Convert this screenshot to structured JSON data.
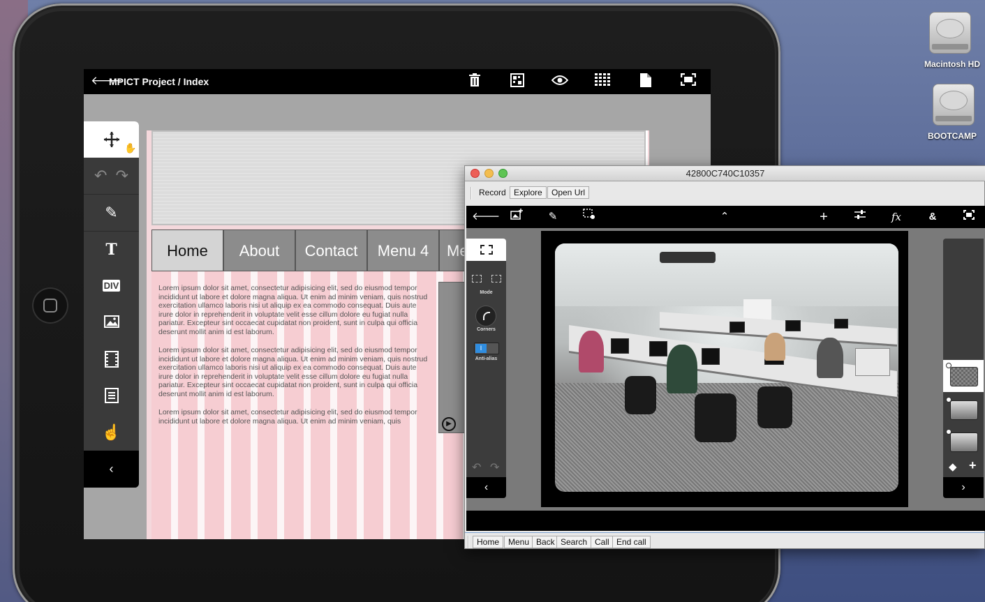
{
  "desktop": {
    "drives": [
      {
        "label": "Macintosh HD"
      },
      {
        "label": "BOOTCAMP"
      }
    ]
  },
  "ipad_app": {
    "title": "MPICT Project / Index",
    "toolbar_icons": [
      "trash-icon",
      "grid-icon",
      "eye-icon",
      "columns-icon",
      "page-icon",
      "fullscreen-icon"
    ],
    "tools": [
      "move-tool",
      "undo-redo",
      "pen-tool",
      "text-tool",
      "div-tool",
      "image-tool",
      "video-tool",
      "form-tool",
      "touch-tool"
    ],
    "div_label": "DIV",
    "text_label": "T",
    "nav": [
      "Home",
      "About",
      "Contact",
      "Menu 4",
      "Me"
    ],
    "lorem": [
      "Lorem ipsum dolor sit amet, consectetur adipisicing elit, sed do eiusmod tempor incididunt ut labore et dolore magna aliqua. Ut enim ad minim veniam, quis nostrud exercitation ullamco laboris nisi ut aliquip ex ea commodo consequat. Duis aute irure dolor in reprehenderit in voluptate velit esse cillum dolore eu fugiat nulla pariatur. Excepteur sint occaecat cupidatat non proident, sunt in culpa qui officia deserunt mollit anim id est laborum.",
      "Lorem ipsum dolor sit amet, consectetur adipisicing elit, sed do eiusmod tempor incididunt ut labore et dolore magna aliqua. Ut enim ad minim veniam, quis nostrud exercitation ullamco laboris nisi ut aliquip ex ea commodo consequat. Duis aute irure dolor in reprehenderit in voluptate velit esse cillum dolore eu fugiat nulla pariatur. Excepteur sint occaecat cupidatat non proident, sunt in culpa qui officia deserunt mollit anim id est laborum.",
      "Lorem ipsum dolor sit amet, consectetur adipisicing elit, sed do eiusmod tempor incididunt ut labore et dolore magna aliqua. Ut enim ad minim veniam, quis"
    ]
  },
  "window": {
    "title": "42800C740C10357",
    "toolbar": {
      "record": "Record",
      "explore": "Explore",
      "open_url": "Open Url"
    },
    "app_icons": [
      "back-icon",
      "add-image-icon",
      "brush-icon",
      "select-settings-icon",
      "chevron-up-icon",
      "plus-icon",
      "sliders-icon",
      "fx-icon",
      "ampersand-icon",
      "fullscreen-icon"
    ],
    "fx_label": "fx",
    "amp_label": "&",
    "left_panel": {
      "mode": "Mode",
      "corners": "Corners",
      "anti_alias": "Anti-alias"
    },
    "bottom_buttons": {
      "home": "Home",
      "menu": "Menu",
      "back": "Back",
      "search": "Search",
      "call": "Call",
      "end_call": "End call"
    }
  }
}
